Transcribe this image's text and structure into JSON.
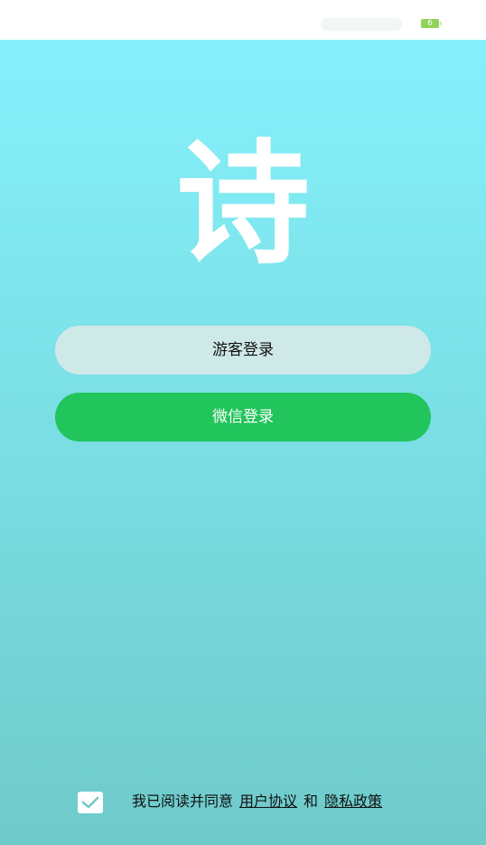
{
  "status_bar": {
    "battery_level": "6"
  },
  "logo": {
    "text": "诗"
  },
  "buttons": {
    "guest_login": "游客登录",
    "wechat_login": "微信登录"
  },
  "agreement": {
    "checked": true,
    "prefix": "我已阅读并同意",
    "user_agreement": "用户协议",
    "and": "和",
    "privacy_policy": "隐私政策"
  },
  "colors": {
    "gradient_top": "#86f0fb",
    "gradient_bottom": "#6fcaca",
    "guest_button": "#cfe9e8",
    "wechat_button": "#22c45c",
    "battery": "#8fd35a"
  }
}
